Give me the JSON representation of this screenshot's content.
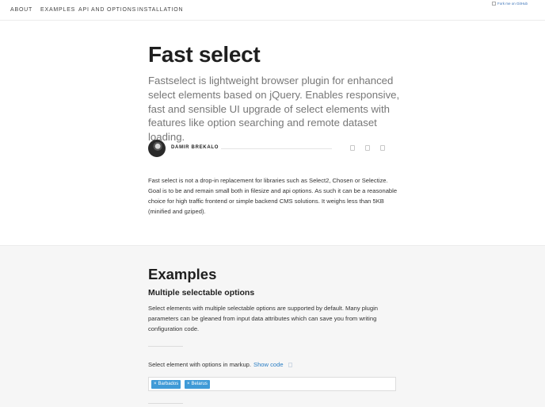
{
  "nav": {
    "items": [
      {
        "label": "ABOUT"
      },
      {
        "label": "EXAMPLES"
      },
      {
        "label": "API AND OPTIONS"
      },
      {
        "label": "INSTALLATION"
      }
    ],
    "fork_me": "Fork me on GitHub"
  },
  "hero": {
    "title": "Fast select",
    "lead": "Fastselect is lightweight browser plugin for enhanced select elements based on jQuery. Enables responsive, fast and sensible UI upgrade of select elements with features like option searching and remote dataset loading.",
    "author": "DAMIR BREKALO",
    "share_icons": [
      "share-icon",
      "share-icon",
      "share-icon"
    ]
  },
  "intro": {
    "text": "Fast select is not a drop-in replacement for libraries such as Select2, Chosen or Selectize. Goal is to be and remain small both in filesize and api options. As such it can be a reasonable choice for high traffic frontend or simple backend CMS solutions. It weighs less than 5KB (minified and gziped)."
  },
  "examples": {
    "title": "Examples",
    "subtitle": "Multiple selectable options",
    "description": "Select elements with multiple selectable options are supported by default. Many plugin parameters can be gleaned from input data attributes which can save you from writing configuration code.",
    "select_label": "Select element with options in markup.",
    "show_code": "Show code",
    "selected": [
      "Barbados",
      "Belarus"
    ],
    "remove_glyph": "×"
  },
  "colors": {
    "accent": "#3f9ad7",
    "link": "#2a7ec4",
    "section_bg": "#f6f6f6"
  }
}
